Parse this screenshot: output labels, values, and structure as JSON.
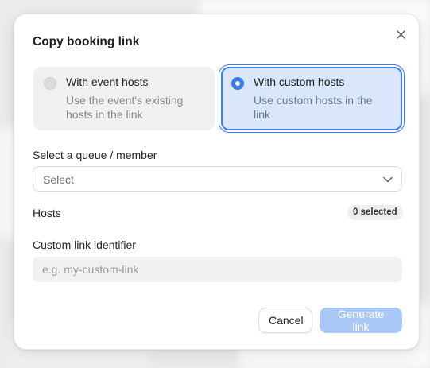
{
  "dialog": {
    "title": "Copy booking link",
    "close_icon": "close-icon"
  },
  "host_options": [
    {
      "title": "With event hosts",
      "description": "Use the event's existing hosts in the link",
      "selected": false
    },
    {
      "title": "With custom hosts",
      "description": "Use custom hosts in the link",
      "selected": true
    }
  ],
  "queue_select": {
    "label": "Select a queue / member",
    "value": "Select",
    "icon": "chevron-down-icon"
  },
  "hosts": {
    "label": "Hosts",
    "badge": "0 selected"
  },
  "custom_link": {
    "label": "Custom link identifier",
    "value": "",
    "placeholder": "e.g. my-custom-link"
  },
  "footer": {
    "cancel_label": "Cancel",
    "generate_label": "Generate link"
  },
  "colors": {
    "accent": "#3b7de8",
    "selected_bg": "#d9e6fb",
    "disabled_button": "#a9c8f6"
  }
}
